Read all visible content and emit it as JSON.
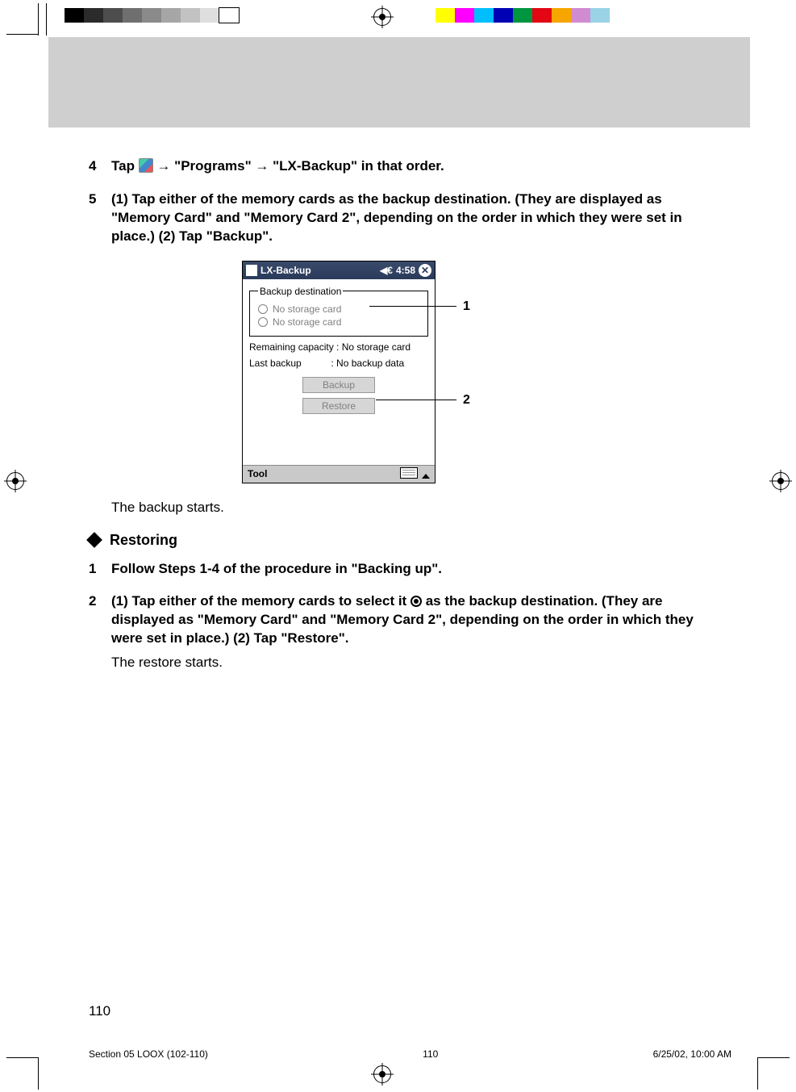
{
  "regbar_colors_left": [
    "#000000",
    "#2b2b2b",
    "#4d4d4d",
    "#6f6f6f",
    "#8a8a8a",
    "#a6a6a6",
    "#c2c2c2",
    "#dedede",
    "#ffffff"
  ],
  "regbar_colors_right": [
    "#ffff00",
    "#ff00ff",
    "#00bfff",
    "#0000b5",
    "#009640",
    "#e30613",
    "#f7a600",
    "#d18bd1",
    "#9ad2e6"
  ],
  "steps_a": {
    "s4": {
      "num": "4",
      "pre": "Tap ",
      "arrow": "→",
      "p1": "\"Programs\"",
      "p2": "\"LX-Backup\" in that order."
    },
    "s5": {
      "num": "5",
      "text": "(1) Tap either of the memory cards as the backup destination. (They are displayed as \"Memory Card\" and \"Memory Card 2\", depending on the order in which they were set in place.) (2) Tap \"Backup\"."
    },
    "backup_starts": "The backup starts."
  },
  "restoring": {
    "heading": "Restoring",
    "s1": {
      "num": "1",
      "text": "Follow Steps 1-4 of the procedure in \"Backing up\"."
    },
    "s2": {
      "num": "2",
      "text_a": "(1) Tap either of the memory cards to select it ",
      "text_b": " as the backup destination. (They are displayed as \"Memory Card\" and \"Memory Card 2\", depending on the order in which they were set in place.) (2) Tap \"Restore\".",
      "note": "The restore starts."
    }
  },
  "shot": {
    "title": "LX-Backup",
    "time": "4:58",
    "fieldset_legend": "Backup destination",
    "opt1": "No storage card",
    "opt2": "No storage card",
    "remaining": "Remaining capacity : No storage card",
    "last": "Last backup           : No backup data",
    "btn_backup": "Backup",
    "btn_restore": "Restore",
    "tool": "Tool",
    "callout1": "1",
    "callout2": "2"
  },
  "footer": {
    "page": "110",
    "slug_left": "Section 05 LOOX (102-110)",
    "slug_mid": "110",
    "slug_right": "6/25/02, 10:00 AM"
  }
}
